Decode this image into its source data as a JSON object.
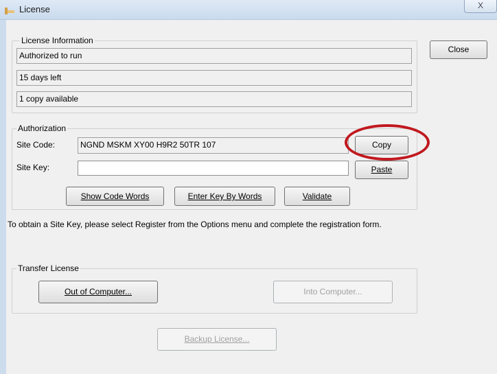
{
  "window": {
    "title": "License",
    "close_glyph": "X"
  },
  "license_info": {
    "group_label": "License Information",
    "status": "Authorized to run",
    "days_left": "15 days left",
    "copies": "1 copy available"
  },
  "buttons": {
    "close": "Close",
    "copy": "Copy",
    "paste": "Paste",
    "show_code_words": "Show Code Words",
    "enter_key_by_words": "Enter Key By Words",
    "validate": "Validate",
    "out_of_computer": "Out of Computer...",
    "into_computer": "Into Computer...",
    "backup_license": "Backup License..."
  },
  "authorization": {
    "group_label": "Authorization",
    "site_code_label": "Site Code:",
    "site_code_value": "NGND MSKM XY00 H9R2 50TR 107",
    "site_key_label": "Site Key:",
    "site_key_value": ""
  },
  "note": "To obtain a Site Key, please select Register from the Options menu and complete the registration form.",
  "transfer": {
    "group_label": "Transfer License"
  },
  "annotation": {
    "highlight_color": "#c0181e"
  }
}
